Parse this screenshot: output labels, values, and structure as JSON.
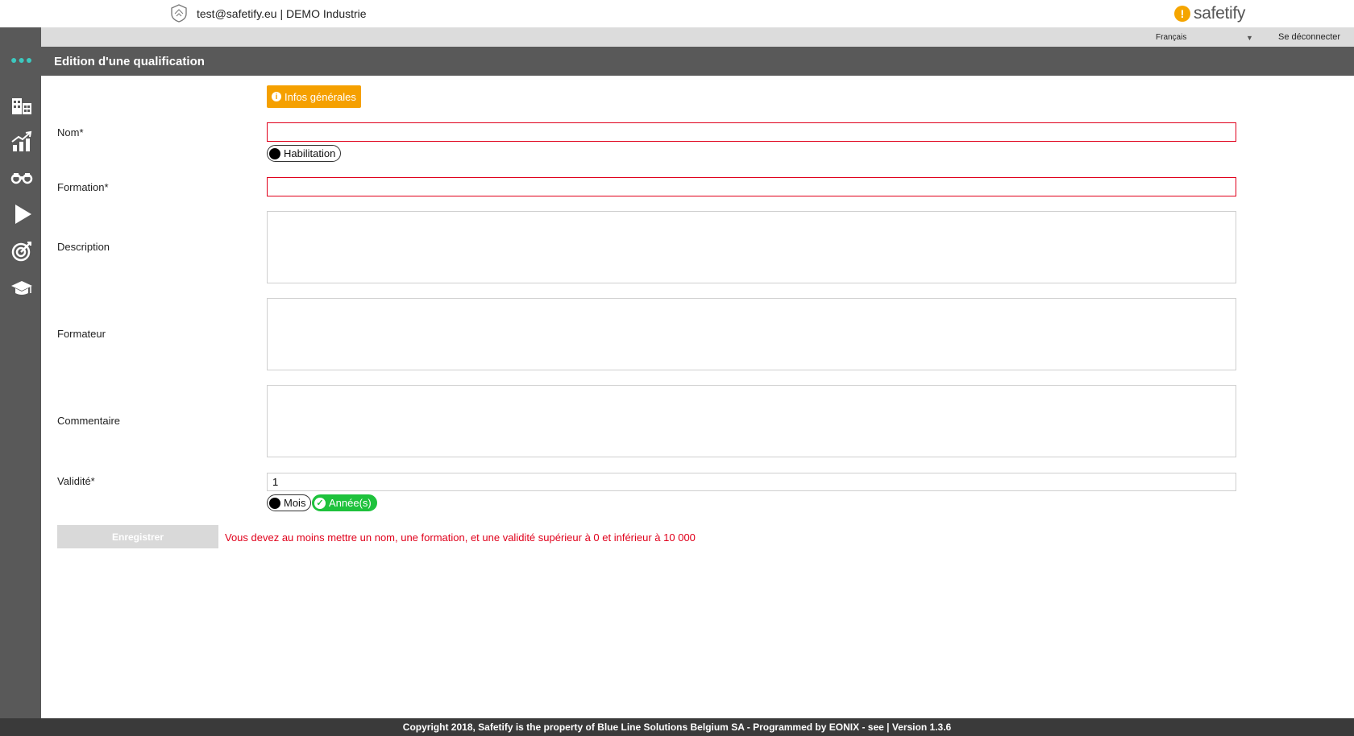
{
  "header": {
    "user": "test@safetify.eu | DEMO Industrie",
    "brand": "safetify",
    "language": "Français",
    "logout": "Se déconnecter"
  },
  "sidebar": {
    "items": [
      {
        "icon": "buildings-icon"
      },
      {
        "icon": "chart-up-icon"
      },
      {
        "icon": "binoculars-icon"
      },
      {
        "icon": "play-icon"
      },
      {
        "icon": "target-icon"
      },
      {
        "icon": "graduation-cap-icon"
      }
    ]
  },
  "page": {
    "title": "Edition d'une qualification"
  },
  "tabs": {
    "general": "Infos générales"
  },
  "form": {
    "nom_label": "Nom*",
    "nom_value": "",
    "habilitation_label": "Habilitation",
    "formation_label": "Formation*",
    "formation_value": "",
    "description_label": "Description",
    "formateur_label": "Formateur",
    "commentaire_label": "Commentaire",
    "validite_label": "Validité*",
    "validite_value": "1",
    "unit_mois": "Mois",
    "unit_annees": "Année(s)",
    "save_label": "Enregistrer",
    "error_message": "Vous devez au moins mettre un nom, une formation, et une validité supérieur à 0 et inférieur à 10 000"
  },
  "footer": {
    "text": "Copyright 2018, Safetify is the property of Blue Line Solutions Belgium SA - Programmed by EONIX - see | Version 1.3.6"
  },
  "colors": {
    "accent": "#f5a000",
    "error": "#e0001b",
    "active_toggle": "#1ec23c",
    "sidebar": "#595959"
  }
}
